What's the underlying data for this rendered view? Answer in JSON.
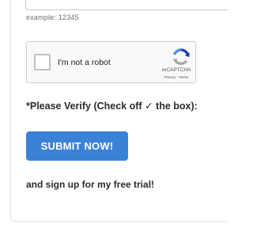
{
  "form": {
    "zip_hint": "example: 12345",
    "zip_value": ""
  },
  "recaptcha": {
    "checkbox_label": "I'm not a robot",
    "brand": "reCAPTCHA",
    "privacy": "Privacy",
    "separator": " - ",
    "terms": "Terms",
    "logo_icon": "recaptcha-logo-icon",
    "colors": {
      "blue": "#1c3aa9",
      "light_blue": "#4a90e2",
      "gray": "#a6a6a6"
    }
  },
  "verify": {
    "text_before": "*Please Verify (Check off ",
    "check_glyph": "✓",
    "text_after": " the box):"
  },
  "submit": {
    "label": "SUBMIT NOW!",
    "color": "#3b82d6"
  },
  "signup": {
    "text": "and sign up for my free trial!"
  }
}
